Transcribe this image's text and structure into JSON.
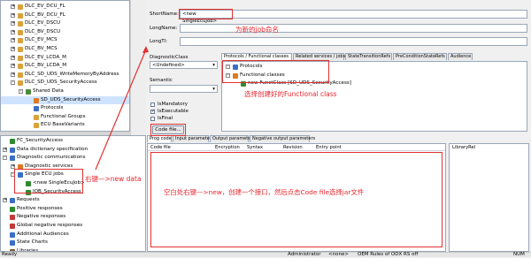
{
  "top_tree": {
    "items": [
      {
        "label": "DLC_EV_DCU_FL",
        "indent": 1,
        "expander": "+",
        "icon": "folder-icon",
        "color": "#d9a23a"
      },
      {
        "label": "DLC_BV_DCU_FL",
        "indent": 1,
        "expander": "+",
        "icon": "folder-icon",
        "color": "#d9a23a"
      },
      {
        "label": "DLC_EV_DSCU",
        "indent": 1,
        "expander": "+",
        "icon": "folder-icon",
        "color": "#d9a23a"
      },
      {
        "label": "DLC_BV_DSCU",
        "indent": 1,
        "expander": "+",
        "icon": "folder-icon",
        "color": "#d9a23a"
      },
      {
        "label": "DLC_EV_MCS",
        "indent": 1,
        "expander": "+",
        "icon": "folder-icon",
        "color": "#d9a23a"
      },
      {
        "label": "DLC_BV_MCS",
        "indent": 1,
        "expander": "+",
        "icon": "folder-icon",
        "color": "#d9a23a"
      },
      {
        "label": "DLC_EV_LCDA_M",
        "indent": 1,
        "expander": "+",
        "icon": "folder-icon",
        "color": "#d9a23a"
      },
      {
        "label": "DLC_BV_LCDA_M",
        "indent": 1,
        "expander": "+",
        "icon": "folder-icon",
        "color": "#d9a23a"
      },
      {
        "label": "DLC_SD_UDS_WriteMemoryByAddress",
        "indent": 1,
        "expander": "+",
        "icon": "folder-icon",
        "color": "#d9a23a"
      },
      {
        "label": "DLC_SD_UDS_SecurityAccess",
        "indent": 1,
        "expander": "-",
        "icon": "folder-icon",
        "color": "#d9a23a"
      },
      {
        "label": "Shared Data",
        "indent": 2,
        "expander": "-",
        "icon": "shared-icon",
        "color": "#4a8a3a"
      },
      {
        "label": "SD_UDS_SecurityAccess",
        "indent": 3,
        "expander": "",
        "icon": "service-icon",
        "color": "#e07820",
        "selected": true
      },
      {
        "label": "Protocols",
        "indent": 3,
        "expander": "",
        "icon": "protocol-icon",
        "color": "#3a6fc4"
      },
      {
        "label": "Functional Groups",
        "indent": 3,
        "expander": "",
        "icon": "folder-icon",
        "color": "#d9a23a"
      },
      {
        "label": "ECU BaseVariants",
        "indent": 3,
        "expander": "",
        "icon": "folder-icon",
        "color": "#d9a23a"
      },
      {
        "label": "ECU Variants",
        "indent": 3,
        "expander": "",
        "icon": "folder-icon",
        "color": "#d9a23a"
      }
    ]
  },
  "bottom_tree": {
    "items": [
      {
        "label": "FC_SecurityAccess",
        "indent": 0,
        "expander": "",
        "icon": "fc-icon",
        "color": "#2f8a2f"
      },
      {
        "label": "Data dictionary specification",
        "indent": 0,
        "expander": "+",
        "icon": "dictionary-icon",
        "color": "#3a6fc4"
      },
      {
        "label": "Diagnostic communications",
        "indent": 0,
        "expander": "-",
        "icon": "comm-icon",
        "color": "#3a6fc4"
      },
      {
        "label": "Diagnostic services",
        "indent": 1,
        "expander": "+",
        "icon": "service-icon",
        "color": "#e07820"
      },
      {
        "label": "Single ECU jobs",
        "indent": 1,
        "expander": "-",
        "icon": "job-icon",
        "color": "#3a6fc4"
      },
      {
        "label": "<new SingleEcuJob>",
        "indent": 2,
        "expander": "",
        "icon": "job-icon",
        "color": "#2f8a2f"
      },
      {
        "label": "JOB_SecurityAccess",
        "indent": 2,
        "expander": "",
        "icon": "job-icon",
        "color": "#2f8a2f"
      },
      {
        "label": "Requests",
        "indent": 0,
        "expander": "+",
        "icon": "request-icon",
        "color": "#3a6fc4"
      },
      {
        "label": "Positive responses",
        "indent": 0,
        "expander": "",
        "icon": "positive-icon",
        "color": "#2f8a2f"
      },
      {
        "label": "Negative responses",
        "indent": 0,
        "expander": "",
        "icon": "negative-icon",
        "color": "#c23a3a"
      },
      {
        "label": "Global negative responses",
        "indent": 0,
        "expander": "",
        "icon": "negative-icon",
        "color": "#c23a3a"
      },
      {
        "label": "Additional Audiences",
        "indent": 0,
        "expander": "",
        "icon": "audience-icon",
        "color": "#3a6fc4"
      },
      {
        "label": "State Charts",
        "indent": 0,
        "expander": "",
        "icon": "chart-icon",
        "color": "#3a6fc4"
      },
      {
        "label": "Libraries",
        "indent": 0,
        "expander": "",
        "icon": "library-icon",
        "color": "#7a5a3a"
      },
      {
        "label": "Diagnostic variables",
        "indent": 0,
        "expander": "",
        "icon": "variable-icon",
        "color": "#3a6fc4"
      }
    ]
  },
  "properties": {
    "short_name_label": "ShortName:",
    "short_name_value": "<new SingleEcuJob>",
    "long_name_label": "LongName:",
    "long_name_value": "",
    "long_id_label": "LongTI:",
    "long_id_value": "",
    "diag_class_label": "DiagnosticClass",
    "diag_class_value": "<Undefined>",
    "semantic_label": "Semantic",
    "semantic_value": "",
    "is_mandatory": "IsMandatory",
    "is_executable": "IsExecutable",
    "is_final": "IsFinal",
    "code_file_button": "Code file..."
  },
  "protocol_tabs": [
    "Protocols / Functional classes",
    "Related services / jobs",
    "StateTransitionRefs",
    "PreConditionStateRefs",
    "Audience"
  ],
  "protocol_tree": [
    {
      "label": "Protocols",
      "indent": 0,
      "expander": "-",
      "color": "#3a6fc4"
    },
    {
      "label": "Functional classes",
      "indent": 0,
      "expander": "-",
      "color": "#e07820"
    },
    {
      "label": "new FunctClass [SD_UDS_SecurityAccess]",
      "indent": 1,
      "expander": "",
      "color": "#2f8a2f"
    }
  ],
  "prog_tabs": [
    "Prog code",
    "Input parameters",
    "Output parameters",
    "Negative output parameters"
  ],
  "prog_columns": [
    "Code file",
    "Encryption",
    "Syntax",
    "Revision",
    "Entry point"
  ],
  "library_column": "LibraryRel",
  "annotations": {
    "name_job": "为新的job命名",
    "select_class": "选择创建好的Functional  class",
    "right_click_new": "右键—>new  data",
    "create_interface": "空白处右键—>new，创建一个接口，然后点击Code  file选择jar文件"
  },
  "status": {
    "left": "Ready",
    "user": "Administrator",
    "none": "<none>",
    "oem": "OEM Rules of ODX RS off",
    "num": "NUM"
  },
  "colors": {
    "annotation_red": "#e8252d",
    "selection": "#cfe3ff",
    "tree_border": "#9aa7b8"
  }
}
